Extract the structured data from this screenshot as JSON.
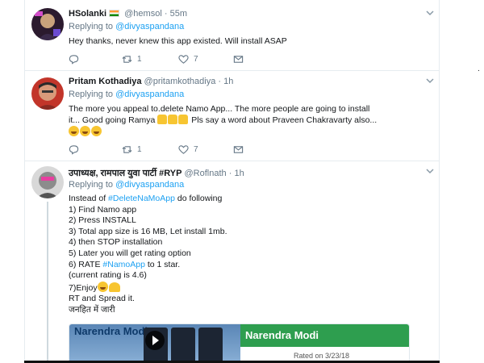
{
  "tweets": [
    {
      "name": "HSolanki",
      "handle": "@hemsol",
      "time": "55m",
      "replying_prefix": "Replying to",
      "replying_to": "@divyaspandana",
      "text": "Hey thanks, never knew this app existed. Will install ASAP",
      "retweets": "1",
      "likes": "7"
    },
    {
      "name": "Pritam Kothadiya",
      "handle": "@pritamkothadiya",
      "time": "1h",
      "replying_prefix": "Replying to",
      "replying_to": "@divyaspandana",
      "text_line1": "The more you appeal to.delete Namo App... The more people are going to install",
      "text_line2a": "it... Good going Ramya",
      "text_line2b": "Pls say a word about Praveen Chakravarty also...",
      "retweets": "1",
      "likes": "7"
    },
    {
      "name": "उपाध्यक्ष, रामपाल युवा पार्टी #RYP",
      "handle": "@Roflnath",
      "time": "1h",
      "replying_prefix": "Replying to",
      "replying_to": "@divyaspandana",
      "instead_prefix": "Instead of",
      "hashtag1": "#DeleteNaMoApp",
      "instead_suffix": "do  following",
      "steps": [
        "1) Find Namo app",
        "2) Press INSTALL",
        "3) Total app size is 16 MB, Let install 1mb.",
        "4) then STOP installation",
        "5) Later you will get rating option"
      ],
      "step6_prefix": "6) RATE",
      "hashtag2": "#NamoApp",
      "step6_suffix": "to 1 star.",
      "current_rating": " (current rating is 4.6)",
      "enjoy": "7)Enjoy",
      "rt": "RT and Spread it.",
      "hindi": "जनहित में जारी",
      "card": {
        "image_title": "Narendra Modi",
        "title": "Narendra Modi",
        "rated": "Rated on 3/23/18"
      }
    }
  ],
  "ui": {
    "dot": "·",
    "right_mark": "."
  },
  "colors": {
    "link": "#1da1f2",
    "muted": "#657786",
    "card_green": "#2e9e4f"
  },
  "icons": [
    "reply-icon",
    "retweet-icon",
    "like-icon",
    "dm-icon",
    "chevron-down-icon",
    "india-flag-icon",
    "play-icon"
  ]
}
